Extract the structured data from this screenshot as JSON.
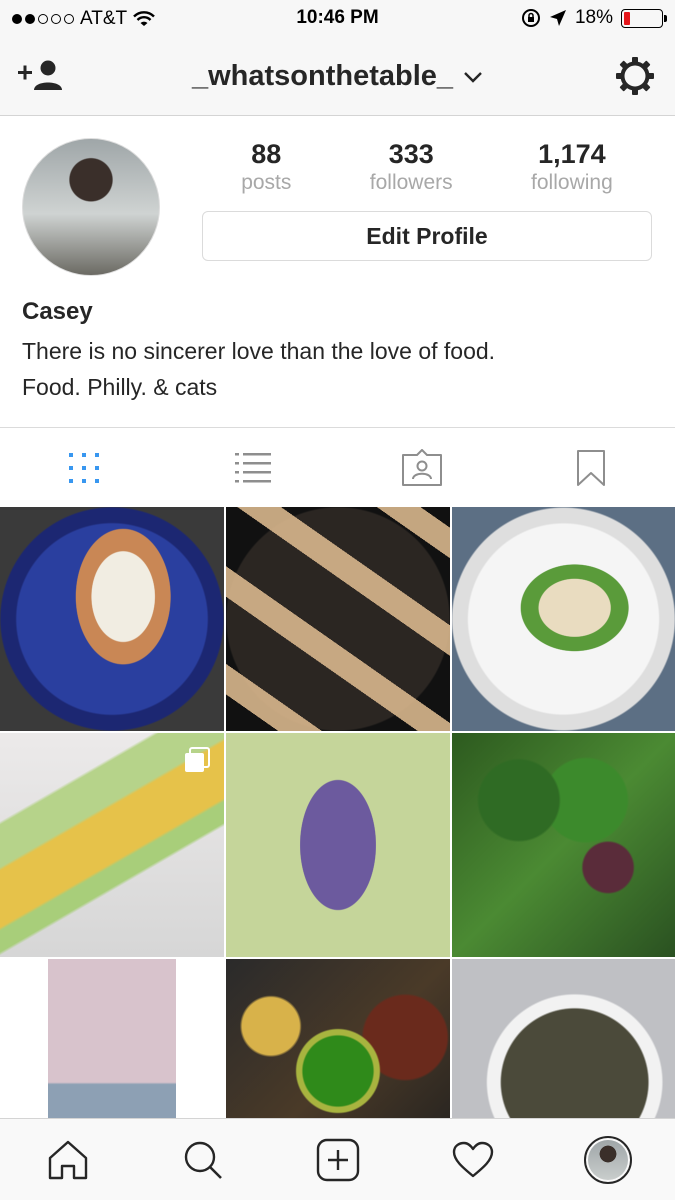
{
  "status_bar": {
    "carrier": "AT&T",
    "time": "10:46 PM",
    "battery_percent": "18%",
    "battery_level": 0.18,
    "battery_color": "#e5161b",
    "signal_bars_filled": 2,
    "signal_bars_total": 5
  },
  "nav": {
    "username": "_whatsonthetable_",
    "add_user_icon": "add-user-icon",
    "settings_icon": "gear-icon",
    "dropdown_icon": "chevron-down-icon"
  },
  "profile": {
    "stats": [
      {
        "value": "88",
        "label": "posts"
      },
      {
        "value": "333",
        "label": "followers"
      },
      {
        "value": "1,174",
        "label": "following"
      }
    ],
    "edit_button": "Edit Profile",
    "name": "Casey",
    "bio_lines": [
      "There is no sincerer love than the love of food.",
      "Food. Philly. & cats"
    ]
  },
  "tabs": [
    {
      "icon": "grid-icon",
      "active": true
    },
    {
      "icon": "list-icon",
      "active": false
    },
    {
      "icon": "tagged-icon",
      "active": false
    },
    {
      "icon": "bookmark-icon",
      "active": false
    }
  ],
  "colors": {
    "accent": "#3897f0",
    "icon": "#262626",
    "muted": "#a8a8a8"
  },
  "grid_posts": [
    {
      "subject": "lobster-roll",
      "multiple": false
    },
    {
      "subject": "king-oyster-mushrooms",
      "multiple": false
    },
    {
      "subject": "shrimp-noodle-salad",
      "multiple": false
    },
    {
      "subject": "lettuce-wraps",
      "multiple": true
    },
    {
      "subject": "roasted-onions",
      "multiple": false
    },
    {
      "subject": "spinach-beet-salad",
      "multiple": false
    },
    {
      "subject": "drink-outdoors",
      "multiple": false
    },
    {
      "subject": "grilled-platter",
      "multiple": false
    },
    {
      "subject": "lentil-bowl",
      "multiple": false
    }
  ],
  "bottom_bar": [
    {
      "icon": "home-icon"
    },
    {
      "icon": "search-icon"
    },
    {
      "icon": "add-post-icon"
    },
    {
      "icon": "heart-icon"
    },
    {
      "icon": "profile-avatar"
    }
  ]
}
